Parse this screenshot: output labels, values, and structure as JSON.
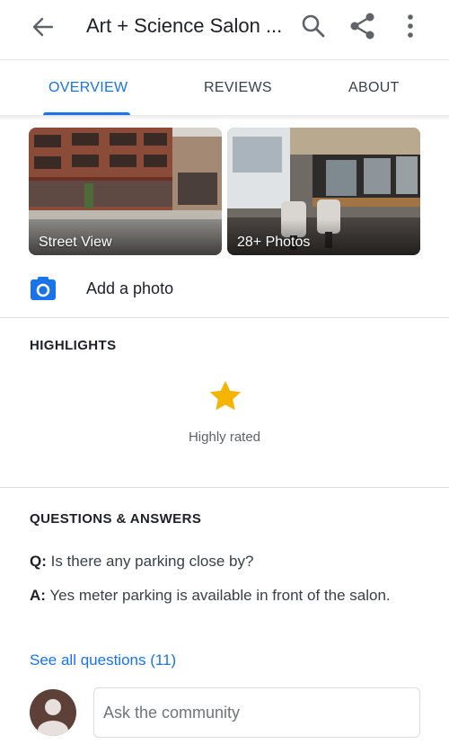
{
  "header": {
    "title": "Art + Science Salon ...",
    "back_icon": "arrow-back-icon",
    "search_icon": "search-icon",
    "share_icon": "share-icon",
    "more_icon": "more-vert-icon"
  },
  "tabs": [
    {
      "label": "OVERVIEW",
      "active": true
    },
    {
      "label": "REVIEWS",
      "active": false
    },
    {
      "label": "ABOUT",
      "active": false
    }
  ],
  "photos": [
    {
      "caption": "Street View"
    },
    {
      "caption": "28+ Photos"
    }
  ],
  "add_photo": {
    "label": "Add a photo",
    "icon": "camera-icon"
  },
  "highlights": {
    "title": "HIGHLIGHTS",
    "items": [
      {
        "label": "Highly rated",
        "icon": "star-icon"
      }
    ]
  },
  "qa": {
    "title": "QUESTIONS & ANSWERS",
    "question_prefix": "Q:",
    "question": " Is there any parking close by?",
    "answer_prefix": "A:",
    "answer": " Yes meter parking is available in front of the salon.",
    "see_all": "See all questions (11)",
    "ask_placeholder": "Ask the community"
  },
  "colors": {
    "accent": "#1a73e8",
    "star": "#f4b400",
    "avatar": "#5d4037"
  }
}
